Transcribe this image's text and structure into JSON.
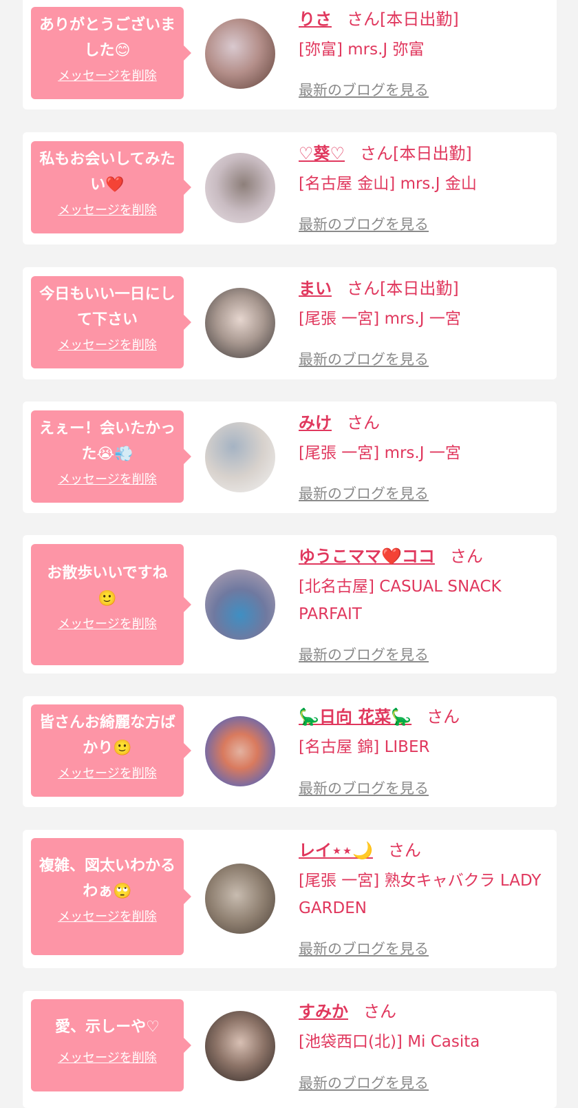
{
  "common": {
    "delete_label": "メッセージを削除",
    "blog_label": "最新のブログを見る",
    "san_label": "さん",
    "on_duty_label": "[本日出勤]"
  },
  "colors": {
    "background": "#f3f3f3",
    "bubble": "#fd95a6",
    "accent": "#e0375d",
    "link_gray": "#8a8a8a"
  },
  "cards": [
    {
      "message": "ありがとうございました😊",
      "name": "りさ",
      "on_duty": true,
      "shop": "[弥富] mrs.J 弥富"
    },
    {
      "message": "私もお会いしてみたい❤️",
      "name": "♡葵♡",
      "on_duty": true,
      "shop": "[名古屋 金山] mrs.J 金山"
    },
    {
      "message": "今日もいい一日にして下さい",
      "name": "まい",
      "on_duty": true,
      "shop": "[尾張 一宮] mrs.J 一宮"
    },
    {
      "message": "えぇー！会いたかった😭💨",
      "name": "みけ",
      "on_duty": false,
      "shop": "[尾張 一宮] mrs.J 一宮"
    },
    {
      "message": "お散歩いいですね🙂",
      "name": "ゆうこママ❤️ココ",
      "on_duty": false,
      "shop": "[北名古屋] CASUAL SNACK PARFAIT"
    },
    {
      "message": "皆さんお綺麗な方ばかり🙂",
      "name": "🦕日向 花菜🦕",
      "on_duty": false,
      "shop": "[名古屋 錦] LIBER"
    },
    {
      "message": "複雑、図太いわかるわぁ🙄",
      "name": "レイ⋆⋆🌙",
      "on_duty": false,
      "shop": "[尾張 一宮] 熟女キャバクラ LADY GARDEN"
    },
    {
      "message": "愛、示しーや♡",
      "name": "すみか",
      "on_duty": false,
      "shop": "[池袋西口(北)] Mi Casita"
    }
  ]
}
